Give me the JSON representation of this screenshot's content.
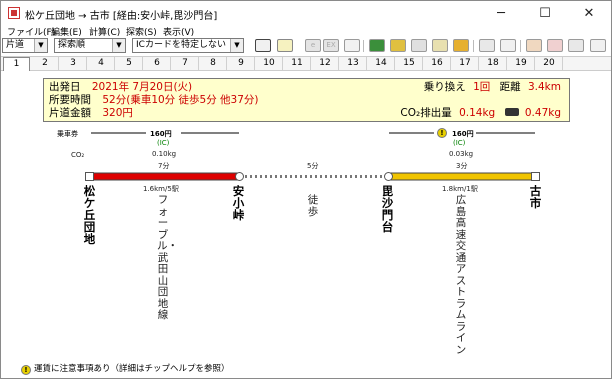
{
  "window": {
    "title": "松ケ丘団地 → 古市 [経由:安小峠,毘沙門台]"
  },
  "menu": {
    "items": [
      "ファイル(F)",
      "編集(E)",
      "計算(C)",
      "探索(S)",
      "表示(V)"
    ]
  },
  "toolbar": {
    "mode_select": "片道",
    "sort_select": "探索順",
    "ic_select": "ICカードを特定しない",
    "gray_buttons": [
      "e",
      "EX"
    ]
  },
  "tabs": {
    "items": [
      "1",
      "2",
      "3",
      "4",
      "5",
      "6",
      "7",
      "8",
      "9",
      "10",
      "11",
      "12",
      "13",
      "14",
      "15",
      "16",
      "17",
      "18",
      "19",
      "20"
    ],
    "active": "1"
  },
  "summary": {
    "depart_label": "出発日",
    "depart_value": "2021年 7月20日(火)",
    "time_label": "所要時間",
    "time_value": "52分",
    "time_detail": "(乗車10分 徒歩5分 他37分)",
    "fare_label": "片道金額",
    "fare_value": "320円",
    "transfer_label": "乗り換え",
    "transfer_value": "1回",
    "distance_label": "距離",
    "distance_value": "3.4km",
    "co2_label": "CO₂排出量",
    "co2_value": "0.14kg",
    "car_value": "0.47kg"
  },
  "route": {
    "ticket_label": "乗車券",
    "co2_header": "CO₂",
    "segments": [
      {
        "fare": "160円",
        "ic": "(IC)",
        "co2": "0.10kg",
        "time": "7分",
        "distance": "1.6km/5駅",
        "line": "フォーブル・武田山団地線",
        "color": "#dd0000"
      },
      {
        "time": "5分",
        "line": "徒歩"
      },
      {
        "fare": "160円",
        "ic": "(IC)",
        "co2": "0.03kg",
        "time": "3分",
        "distance": "1.8km/1駅",
        "line": "広島高速交通アストラムライン",
        "color": "#f0c400"
      }
    ],
    "stations": [
      "松ケ丘団地",
      "安小峠",
      "毘沙門台",
      "古市"
    ]
  },
  "footer": {
    "notice": "運賃に注意事項あり（詳細はチップヘルプを参照）"
  }
}
